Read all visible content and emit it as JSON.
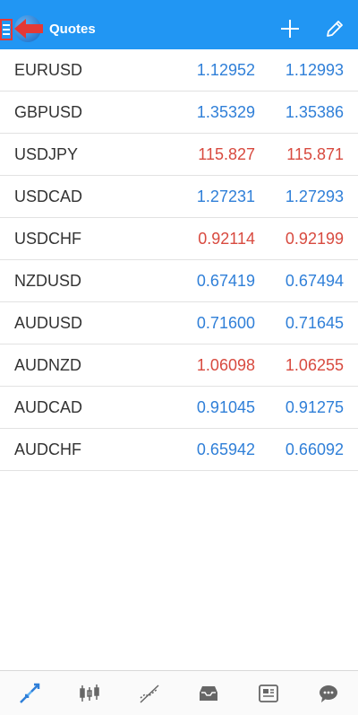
{
  "header": {
    "title": "Quotes",
    "colors": {
      "bar": "#2196f3",
      "highlight": "#e53935"
    }
  },
  "icons": {
    "menu": "hamburger-icon",
    "add": "plus-icon",
    "edit": "pencil-icon"
  },
  "quotes": [
    {
      "symbol": "EURUSD",
      "bid": "1.12952",
      "ask": "1.12993",
      "color": "blue"
    },
    {
      "symbol": "GBPUSD",
      "bid": "1.35329",
      "ask": "1.35386",
      "color": "blue"
    },
    {
      "symbol": "USDJPY",
      "bid": "115.827",
      "ask": "115.871",
      "color": "red"
    },
    {
      "symbol": "USDCAD",
      "bid": "1.27231",
      "ask": "1.27293",
      "color": "blue"
    },
    {
      "symbol": "USDCHF",
      "bid": "0.92114",
      "ask": "0.92199",
      "color": "red"
    },
    {
      "symbol": "NZDUSD",
      "bid": "0.67419",
      "ask": "0.67494",
      "color": "blue"
    },
    {
      "symbol": "AUDUSD",
      "bid": "0.71600",
      "ask": "0.71645",
      "color": "blue"
    },
    {
      "symbol": "AUDNZD",
      "bid": "1.06098",
      "ask": "1.06255",
      "color": "red"
    },
    {
      "symbol": "AUDCAD",
      "bid": "0.91045",
      "ask": "0.91275",
      "color": "blue"
    },
    {
      "symbol": "AUDCHF",
      "bid": "0.65942",
      "ask": "0.66092",
      "color": "blue"
    }
  ],
  "bottom_nav": [
    {
      "name": "quotes-tab",
      "icon": "quotes-arrows-icon",
      "active": true
    },
    {
      "name": "chart-tab",
      "icon": "candlestick-icon",
      "active": false
    },
    {
      "name": "trade-tab",
      "icon": "trend-icon",
      "active": false
    },
    {
      "name": "history-tab",
      "icon": "inbox-icon",
      "active": false
    },
    {
      "name": "news-tab",
      "icon": "newspaper-icon",
      "active": false
    },
    {
      "name": "chat-tab",
      "icon": "chat-bubble-icon",
      "active": false
    }
  ]
}
